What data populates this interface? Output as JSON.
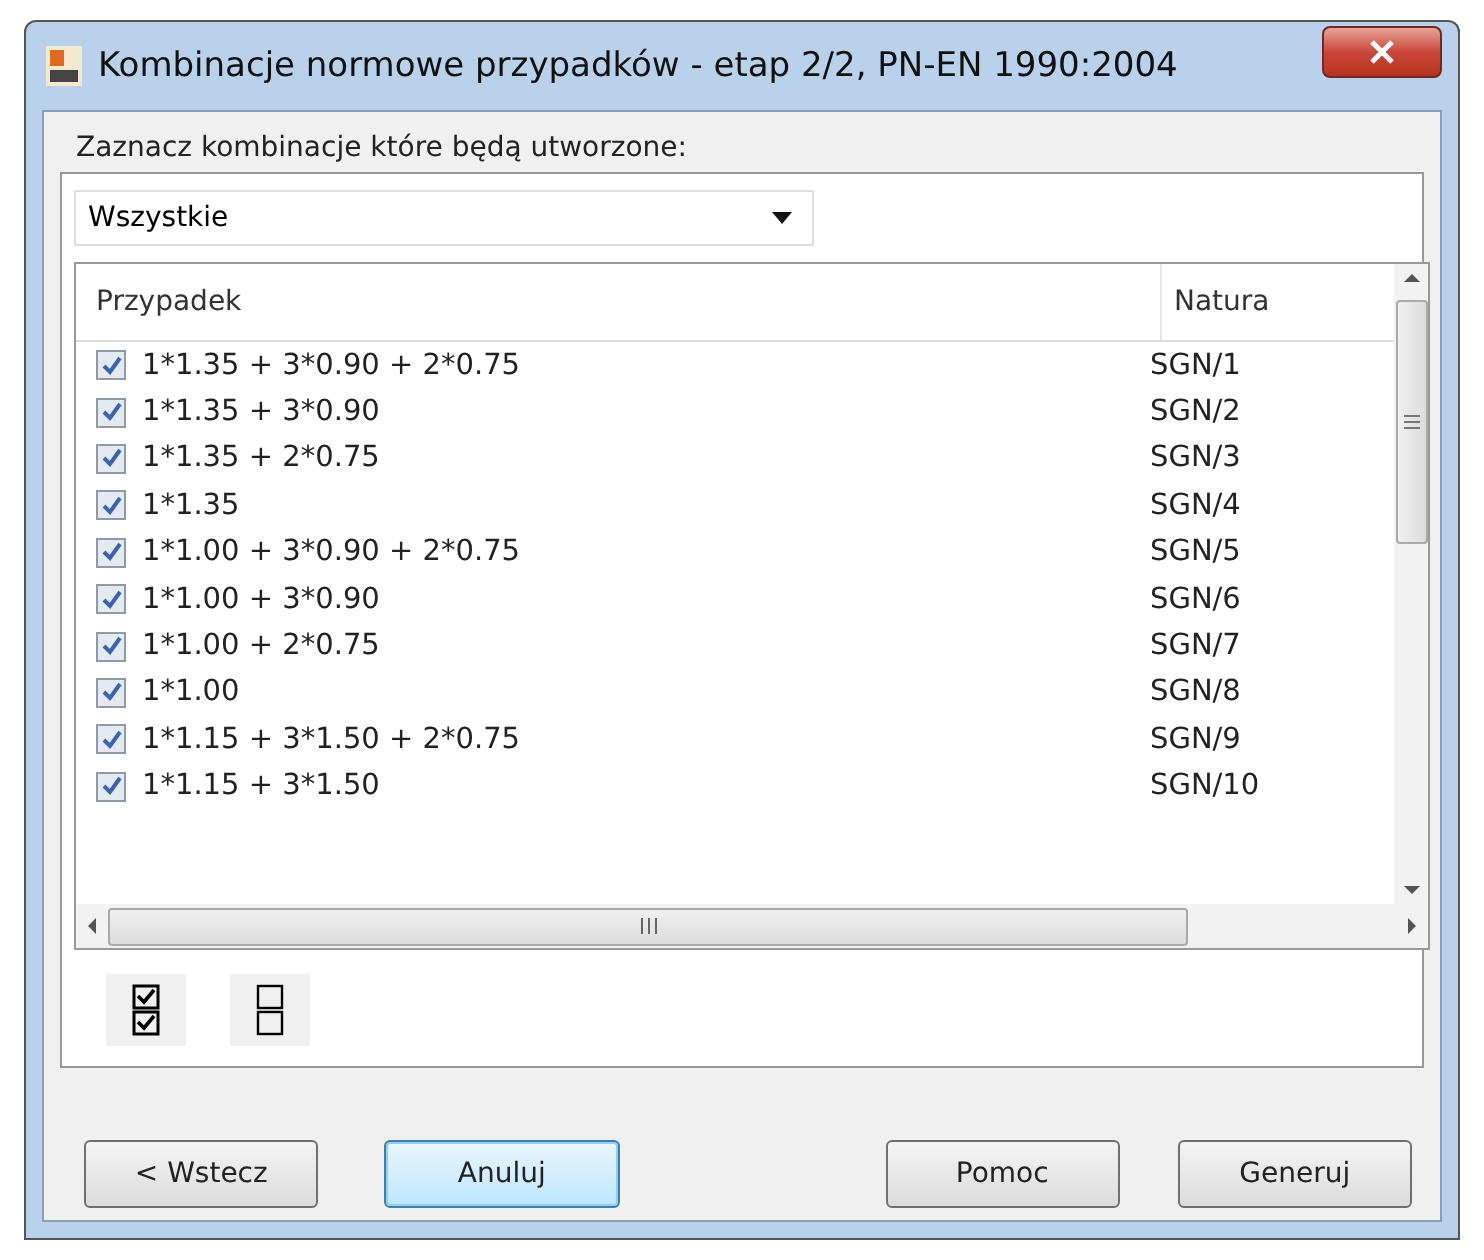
{
  "window": {
    "title": "Kombinacje normowe przypadków - etap 2/2, PN-EN 1990:2004"
  },
  "prompt": "Zaznacz kombinacje które będą utworzone:",
  "filter": {
    "value": "Wszystkie"
  },
  "table": {
    "columns": [
      "Przypadek",
      "Natura"
    ],
    "rows": [
      {
        "case": "1*1.35 + 3*0.90 + 2*0.75",
        "nature": "SGN/1",
        "checked": true
      },
      {
        "case": "1*1.35 + 3*0.90",
        "nature": "SGN/2",
        "checked": true
      },
      {
        "case": "1*1.35 + 2*0.75",
        "nature": "SGN/3",
        "checked": true
      },
      {
        "case": "1*1.35",
        "nature": "SGN/4",
        "checked": true
      },
      {
        "case": "1*1.00 + 3*0.90 + 2*0.75",
        "nature": "SGN/5",
        "checked": true
      },
      {
        "case": "1*1.00 + 3*0.90",
        "nature": "SGN/6",
        "checked": true
      },
      {
        "case": "1*1.00 + 2*0.75",
        "nature": "SGN/7",
        "checked": true
      },
      {
        "case": "1*1.00",
        "nature": "SGN/8",
        "checked": true
      },
      {
        "case": "1*1.15 + 3*1.50 + 2*0.75",
        "nature": "SGN/9",
        "checked": true
      },
      {
        "case": "1*1.15 + 3*1.50",
        "nature": "SGN/10",
        "checked": true
      }
    ]
  },
  "buttons": [
    {
      "label": "< Wstecz",
      "focused": false
    },
    {
      "label": "Anuluj",
      "focused": true
    },
    {
      "label": "Pomoc",
      "focused": false
    },
    {
      "label": "Generuj",
      "focused": false
    }
  ]
}
